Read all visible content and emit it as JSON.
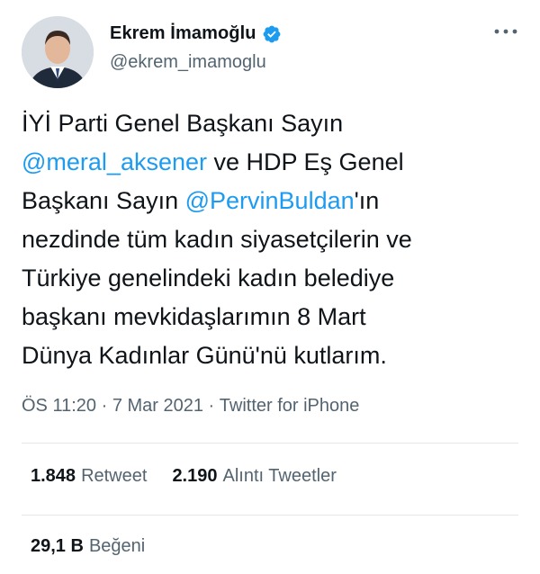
{
  "author": {
    "name": "Ekrem İmamoğlu",
    "handle": "@ekrem_imamoglu",
    "verified": true,
    "avatar_icon": "profile-photo"
  },
  "tweet": {
    "lines": [
      [
        {
          "t": "İYİ Parti Genel Başkanı Sayın "
        }
      ],
      [
        {
          "t": "@meral_aksener",
          "mention": true
        },
        {
          "t": " ve HDP Eş Genel"
        }
      ],
      [
        {
          "t": "Başkanı Sayın "
        },
        {
          "t": "@PervinBuldan",
          "mention": true
        },
        {
          "t": "'ın"
        }
      ],
      [
        {
          "t": "nezdinde tüm kadın siyasetçilerin ve"
        }
      ],
      [
        {
          "t": "Türkiye genelindeki kadın belediye"
        }
      ],
      [
        {
          "t": "başkanı mevkidaşlarımın 8 Mart"
        }
      ],
      [
        {
          "t": "Dünya Kadınlar Günü'nü kutlarım."
        }
      ]
    ]
  },
  "meta": {
    "time": "ÖS 11:20",
    "separator": " · ",
    "date": "7 Mar 2021",
    "app": "Twitter for iPhone"
  },
  "stats": {
    "retweets_count": "1.848",
    "retweets_label": "Retweet",
    "quotes_count": "2.190",
    "quotes_label": "Alıntı Tweetler",
    "likes_count": "29,1 B",
    "likes_label": "Beğeni"
  },
  "colors": {
    "accent": "#1d9bf0",
    "secondary_text": "#536471",
    "divider": "#e3e7ea"
  },
  "icons": {
    "verified": "verified-badge-icon",
    "more": "more-horizontal-icon"
  }
}
